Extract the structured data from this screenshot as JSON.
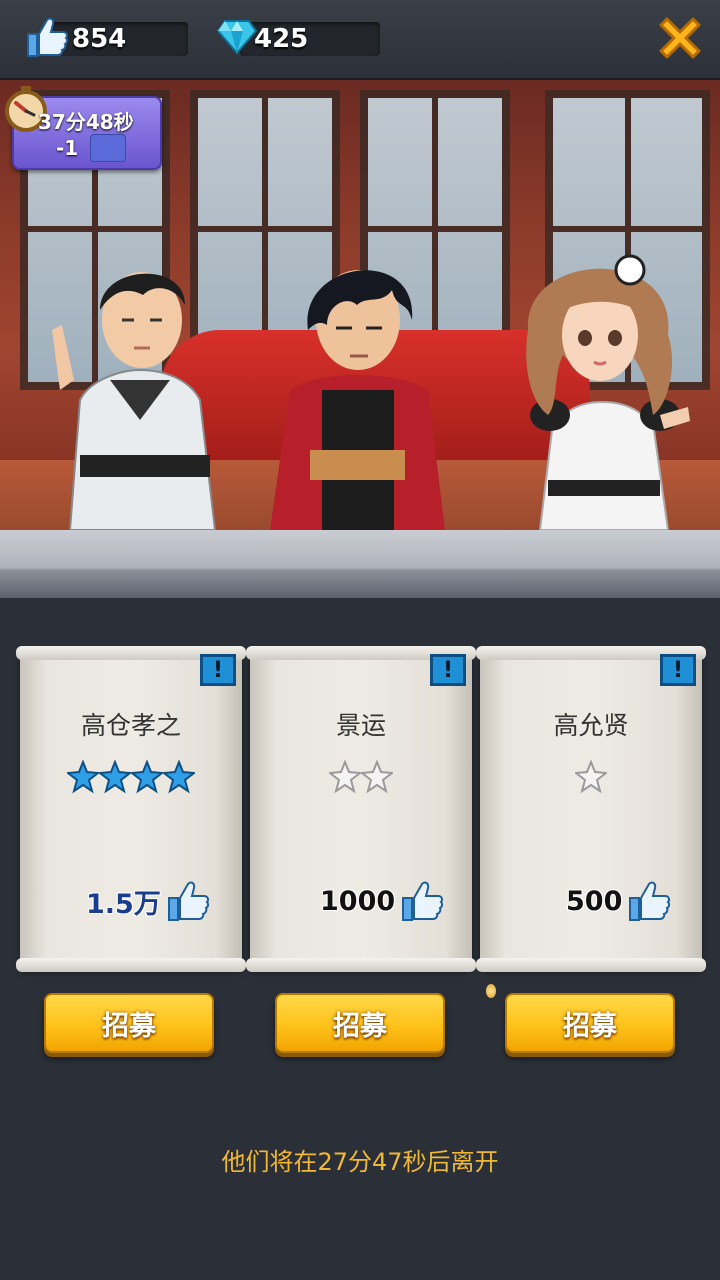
{
  "topbar": {
    "likes": {
      "icon": "thumbs-up-icon",
      "value": "854"
    },
    "gems": {
      "icon": "diamond-icon",
      "value": "425"
    },
    "close_icon": "close-icon"
  },
  "timer": {
    "icon": "stopwatch-icon",
    "time": "37分48秒",
    "cost": "-1",
    "cost_icon": "ticket-icon"
  },
  "cards": [
    {
      "name": "高仓孝之",
      "stars": 4,
      "star_color": "blue",
      "cost": "1.5万",
      "cost_color": "blue"
    },
    {
      "name": "景运",
      "stars": 2,
      "star_color": "white",
      "cost": "1000",
      "cost_color": "black"
    },
    {
      "name": "高允贤",
      "stars": 1,
      "star_color": "white",
      "cost": "500",
      "cost_color": "black"
    }
  ],
  "info_label": "!",
  "recruit_label": "招募",
  "footer": {
    "leave_message": "他们将在27分47秒后离开"
  },
  "colors": {
    "accent_gold": "#ffc21a",
    "message": "#f2b833",
    "star_blue": "#2f9fe8",
    "timer_purple": "#7f6be0"
  }
}
